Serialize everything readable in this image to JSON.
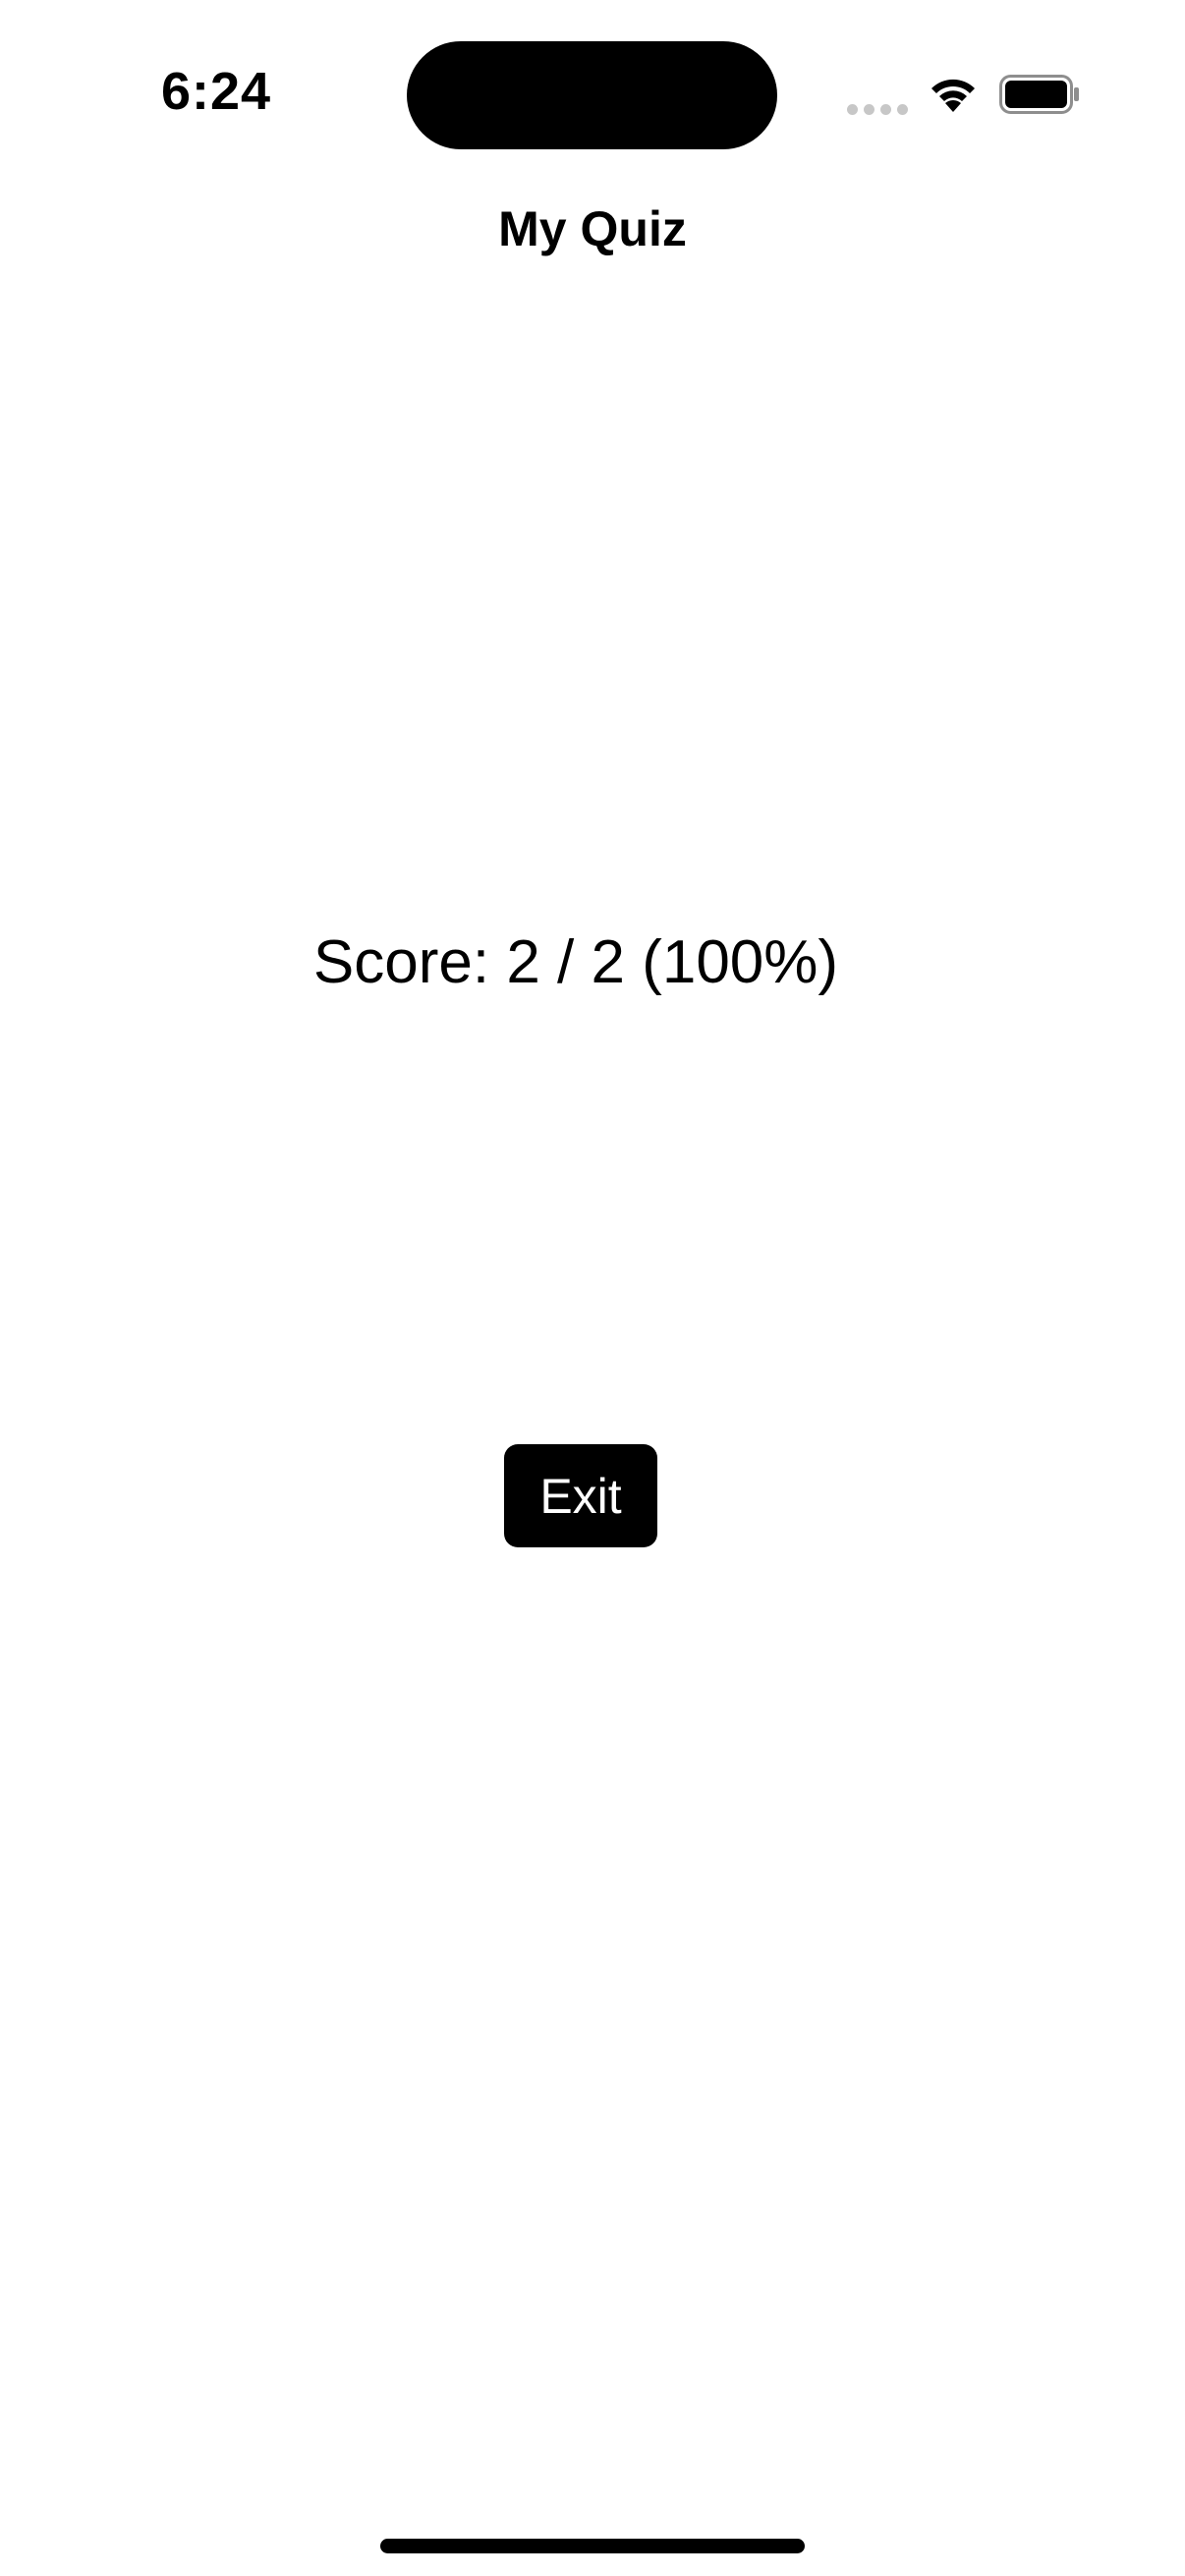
{
  "status_bar": {
    "time": "6:24",
    "signal_icon": "cellular-signal-icon",
    "wifi_icon": "wifi-icon",
    "battery_icon": "battery-icon"
  },
  "nav": {
    "title": "My Quiz"
  },
  "result": {
    "score_text": "Score: 2 / 2 (100%)"
  },
  "actions": {
    "exit_label": "Exit"
  },
  "colors": {
    "background": "#ffffff",
    "text": "#000000",
    "button_background": "#000000",
    "button_text": "#ffffff"
  }
}
